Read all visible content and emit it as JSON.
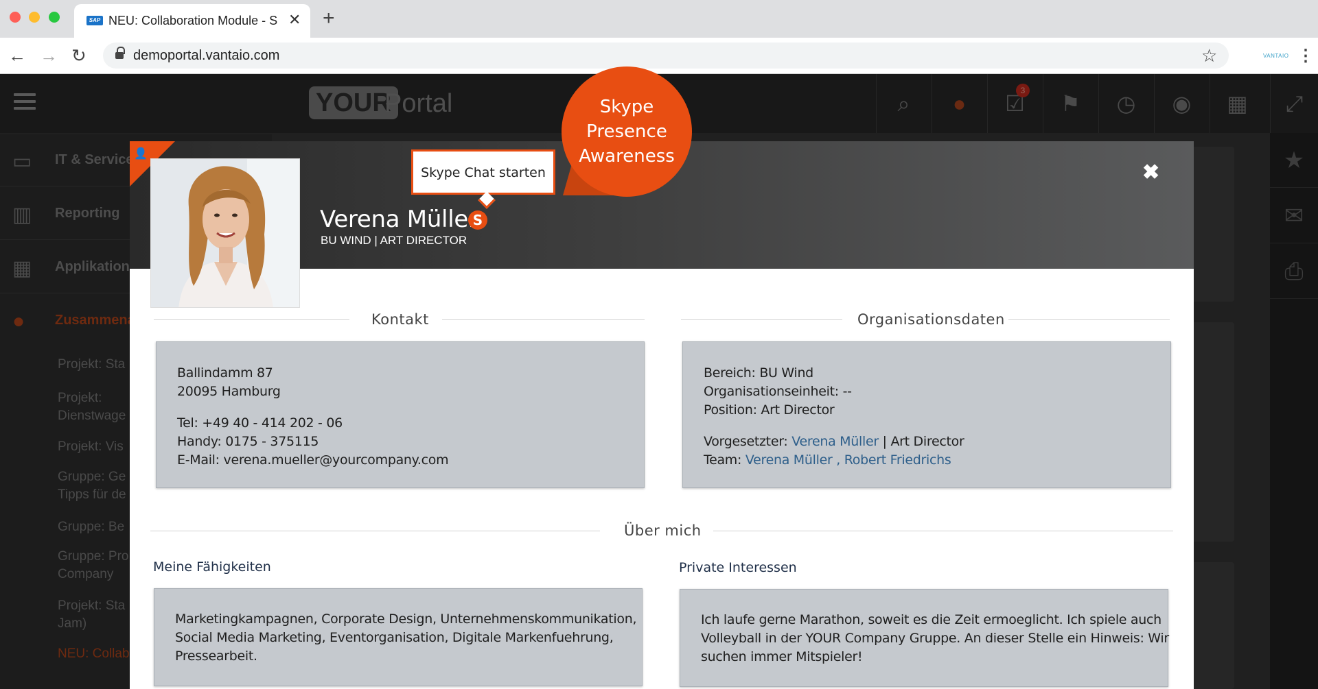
{
  "browser": {
    "tab_title": "NEU: Collaboration Module - S",
    "tab_favicon": "SAP",
    "url": "demoportal.vantaio.com",
    "extension_label": "VANTAIO"
  },
  "portal": {
    "logo_box": "YOUR",
    "logo_text": "Portal",
    "notification_count": "3",
    "sidebar": {
      "items": [
        {
          "label": "IT & Service"
        },
        {
          "label": "Reporting"
        },
        {
          "label": "Applikation"
        },
        {
          "label": "Zusammena"
        }
      ],
      "subitems": [
        "Projekt: Sta",
        "Projekt: Dienstwage",
        "Projekt: Vis",
        "Gruppe: Ge Tipps für de",
        "Gruppe: Be",
        "Gruppe: Pro Company",
        "Projekt: Sta Jam)",
        "NEU: Collab"
      ]
    }
  },
  "callout": {
    "line1": "Skype",
    "line2": "Presence",
    "line3": "Awareness"
  },
  "profile": {
    "name": "Verena Müller",
    "role": "BU WIND | ART DIRECTOR",
    "skype_tooltip": "Skype Chat starten",
    "close": "✖"
  },
  "kontakt": {
    "title": "Kontakt",
    "street": "Ballindamm 87",
    "city": "20095 Hamburg",
    "tel": "Tel: +49 40 - 414 202 - 06",
    "handy": "Handy: 0175 - 375115",
    "email": "E-Mail: verena.mueller@yourcompany.com"
  },
  "organisation": {
    "title": "Organisationsdaten",
    "bereich": "Bereich: BU Wind",
    "einheit": "Organisationseinheit: --",
    "position": "Position: Art Director",
    "vorgesetzter_label": "Vorgesetzter: ",
    "vorgesetzter_name": "Verena Müller",
    "vorgesetzter_suffix": " | Art Director",
    "team_label": "Team: ",
    "team_member1": "Verena Müller",
    "team_sep": " , ",
    "team_member2": "Robert Friedrichs"
  },
  "ueber_mich": {
    "title": "Über mich",
    "skills_title": "Meine Fähigkeiten",
    "skills_line1": "Marketingkampagnen, Corporate Design, Unternehmenskommunikation,",
    "skills_line2": "Social Media Marketing, Eventorganisation, Digitale Markenfuehrung,",
    "skills_line3": "Pressearbeit.",
    "interests_title": "Private Interessen",
    "interests_line1": "Ich laufe gerne Marathon, soweit es die Zeit ermoeglicht. Ich spiele auch",
    "interests_line2": "Volleyball in der YOUR Company  Gruppe. An dieser Stelle ein Hinweis: Wir",
    "interests_line3": "suchen immer Mitspieler!"
  },
  "colors": {
    "accent": "#e84e12",
    "link": "#2d5e8a",
    "info_box": "#c5c9ce"
  }
}
